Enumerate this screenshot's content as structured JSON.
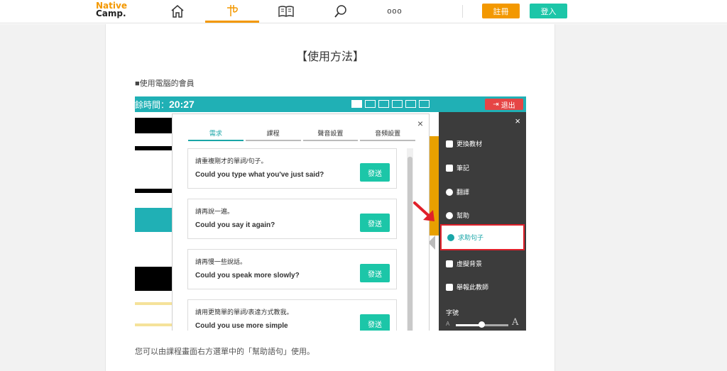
{
  "header": {
    "logo_line1": "Native",
    "logo_line2": "Camp.",
    "nav_icons": [
      "home-icon",
      "lesson-icon",
      "textbook-icon",
      "search-icon",
      "more-icon"
    ],
    "more_label": "ooo",
    "register_label": "註冊",
    "login_label": "登入",
    "accent_color": "#f39800",
    "login_color": "#1cc6a8"
  },
  "main": {
    "title": "【使用方法】",
    "subtitle": "■使用電腦的會員",
    "footer_text": "您可以由課程畫面右方選單中的「幫助語句」使用。"
  },
  "screenshot": {
    "timer_label": "餘時間：",
    "timer_value": "20:27",
    "exit_label": "退出",
    "dialog": {
      "close": "×",
      "tabs": [
        "需求",
        "課程",
        "聲音設置",
        "音頻設置"
      ],
      "active_tab": 0,
      "cards": [
        {
          "zh": "請重複剛才的單詞/句子。",
          "en": "Could you type what you've just said?",
          "send": "發送"
        },
        {
          "zh": "請再說一遍。",
          "en": "Could you say it again?",
          "send": "發送"
        },
        {
          "zh": "請再慢一些說話。",
          "en": "Could you speak more slowly?",
          "send": "發送"
        },
        {
          "zh": "請用更簡單的單詞/表達方式教我。",
          "en": "Could you use more simple",
          "send": "發送"
        }
      ]
    },
    "menu": {
      "close": "×",
      "items": [
        {
          "label": "更換教材",
          "icon": "book-icon"
        },
        {
          "label": "筆記",
          "icon": "edit-icon"
        },
        {
          "label": "翻譯",
          "icon": "globe-icon"
        },
        {
          "label": "幫助",
          "icon": "help-icon"
        },
        {
          "label": "求助句子",
          "icon": "chat-icon"
        },
        {
          "label": "虛擬背景",
          "icon": "image-icon"
        },
        {
          "label": "舉報此教師",
          "icon": "flag-icon"
        }
      ],
      "highlighted_item": 4,
      "font_size_label": "字號",
      "font_small": "A",
      "font_big": "A",
      "font_slider_level": 0.5
    },
    "bar_color": "#20b0b5",
    "exit_color": "#e64545",
    "highlight_border_color": "#e0202a"
  }
}
